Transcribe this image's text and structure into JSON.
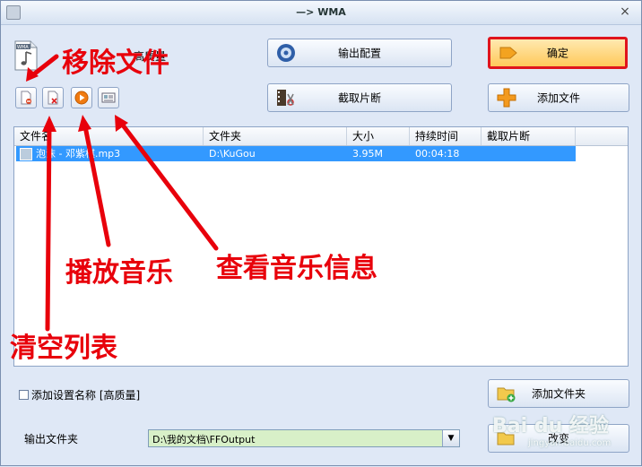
{
  "window": {
    "title": "—> WMA",
    "close_glyph": "×"
  },
  "header": {
    "quality_label": "高质量"
  },
  "buttons": {
    "output_config": "输出配置",
    "ok": "确定",
    "clip": "截取片断",
    "add_file": "添加文件",
    "add_folder": "添加文件夹",
    "change": "改变"
  },
  "table": {
    "columns": [
      "文件名",
      "文件夹",
      "大小",
      "持续时间",
      "截取片断"
    ],
    "rows": [
      {
        "name": "泡沫 - 邓紫棋.mp3",
        "folder": "D:\\KuGou",
        "size": "3.95M",
        "duration": "00:04:18",
        "clip": ""
      }
    ]
  },
  "options": {
    "add_setting_name": "添加设置名称 [高质量]"
  },
  "output": {
    "label": "输出文件夹",
    "path": "D:\\我的文档\\FFOutput",
    "dropdown_glyph": "▼"
  },
  "annotations": {
    "remove_file": "移除文件",
    "play_music": "播放音乐",
    "view_info": "查看音乐信息",
    "clear_list": "清空列表"
  },
  "watermark": {
    "main": "Bai du 经验",
    "sub": "jingyan.baidu.com"
  },
  "colors": {
    "accent_red": "#e0141c",
    "selection": "#3399ff",
    "annotation": "#e8000b"
  }
}
